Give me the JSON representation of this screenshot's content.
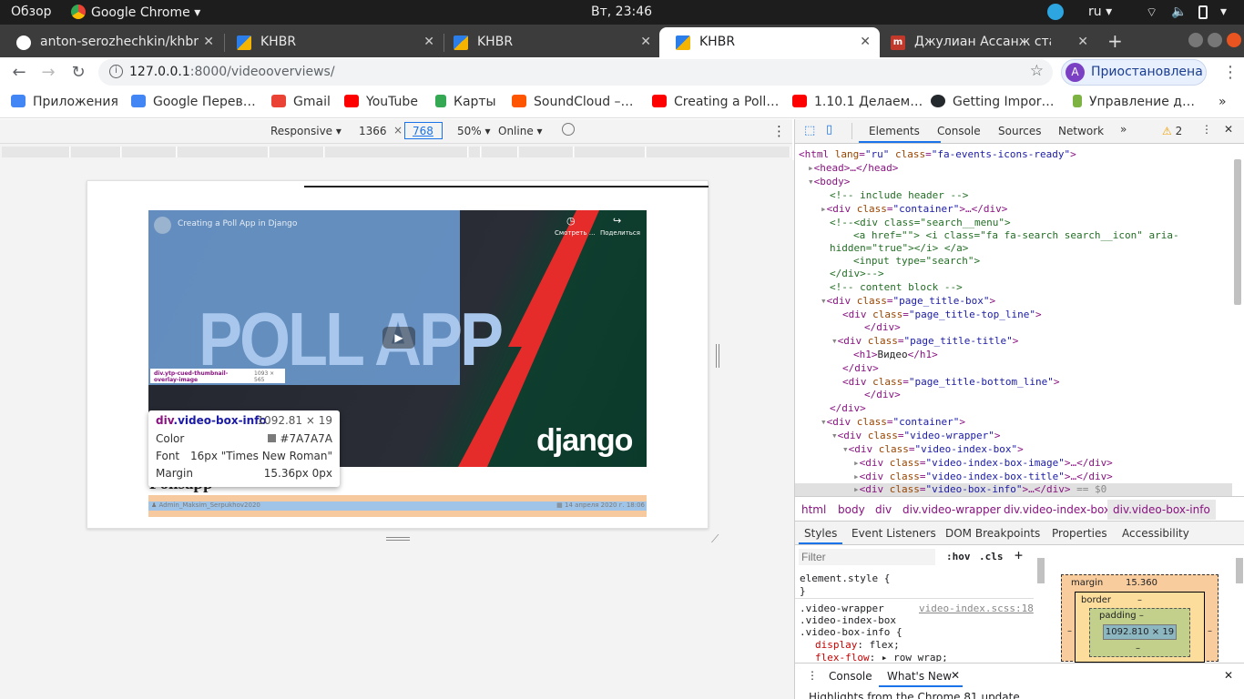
{
  "os": {
    "activities": "Обзор",
    "app": "Google Chrome",
    "clock": "Вт, 23:46",
    "lang": "ru"
  },
  "tabs": [
    {
      "title": "anton-serozhechkin/khbr",
      "active": false
    },
    {
      "title": "KHBR",
      "active": false
    },
    {
      "title": "KHBR",
      "active": false
    },
    {
      "title": "KHBR",
      "active": true
    },
    {
      "title": "Джулиан Ассанж стал от",
      "active": false
    }
  ],
  "toolbar": {
    "url_host": "127.0.0.1",
    "url_rest": ":8000/videooverviews/",
    "profile_label": "Приостановлена",
    "profile_initial": "A"
  },
  "bookmarks": [
    {
      "label": "Приложения",
      "color": "#4285f4"
    },
    {
      "label": "Google Перев…",
      "color": "#4285f4"
    },
    {
      "label": "Gmail",
      "color": "#ea4335"
    },
    {
      "label": "YouTube",
      "color": "#ff0000"
    },
    {
      "label": "Карты",
      "color": "#34a853"
    },
    {
      "label": "SoundCloud –…",
      "color": "#ff5500"
    },
    {
      "label": "Creating a Poll…",
      "color": "#ff0000"
    },
    {
      "label": "1.10.1 Делаем…",
      "color": "#ff0000"
    },
    {
      "label": "Getting Impor…",
      "color": "#24292e"
    },
    {
      "label": "Управление д…",
      "color": "#7cb342"
    }
  ],
  "devicebar": {
    "mode": "Responsive",
    "width": "1366",
    "height": "768",
    "zoom": "50%",
    "network": "Online"
  },
  "video": {
    "title": "Creating a Poll App in Django",
    "big_text": "POLL APP",
    "logo": "django",
    "watch_later": "Смотреть …",
    "share": "Поделиться",
    "overlay_label": "div.ytp-cued-thumbnail-overlay-image",
    "overlay_size": "1093 × 565"
  },
  "page_below": {
    "author": "Admin_Maksim_Serpukhov2020",
    "date": "14 апреля 2020 г. 18:06",
    "title_fragment": "Pollsapp"
  },
  "tooltip": {
    "element": "div",
    "cls": ".video-box-info",
    "size": "1092.81 × 19",
    "rows": [
      {
        "k": "Color",
        "v": "#7A7A7A"
      },
      {
        "k": "Font",
        "v": "16px \"Times New Roman\""
      },
      {
        "k": "Margin",
        "v": "15.36px 0px"
      }
    ]
  },
  "devtools": {
    "tabs": [
      "Elements",
      "Console",
      "Sources",
      "Network"
    ],
    "warn_count": "2",
    "breadcrumbs": [
      "html",
      "body",
      "div",
      "div.video-wrapper",
      "div.video-index-box",
      "div.video-box-info"
    ],
    "style_tabs": [
      "Styles",
      "Event Listeners",
      "DOM Breakpoints",
      "Properties",
      "Accessibility"
    ],
    "filter_placeholder": "Filter",
    "hov": ":hov",
    "cls": ".cls",
    "element_style": "element.style {",
    "rule_selectors": [
      ".video-wrapper",
      ".video-index-box",
      ".video-box-info {"
    ],
    "rule_source": "video-index.scss:18",
    "rule_props": [
      {
        "p": "display",
        "v": "flex;"
      },
      {
        "p": "flex-flow",
        "v": "row wrap;"
      }
    ],
    "box": {
      "margin_label": "margin",
      "margin_val": "15.360",
      "border_label": "border",
      "padding_label": "padding",
      "dash": "–",
      "content": "1092.810 × 19"
    },
    "drawer_tabs": [
      "Console",
      "What's New"
    ],
    "drawer_text": "Highlights from the Chrome 81 update"
  }
}
